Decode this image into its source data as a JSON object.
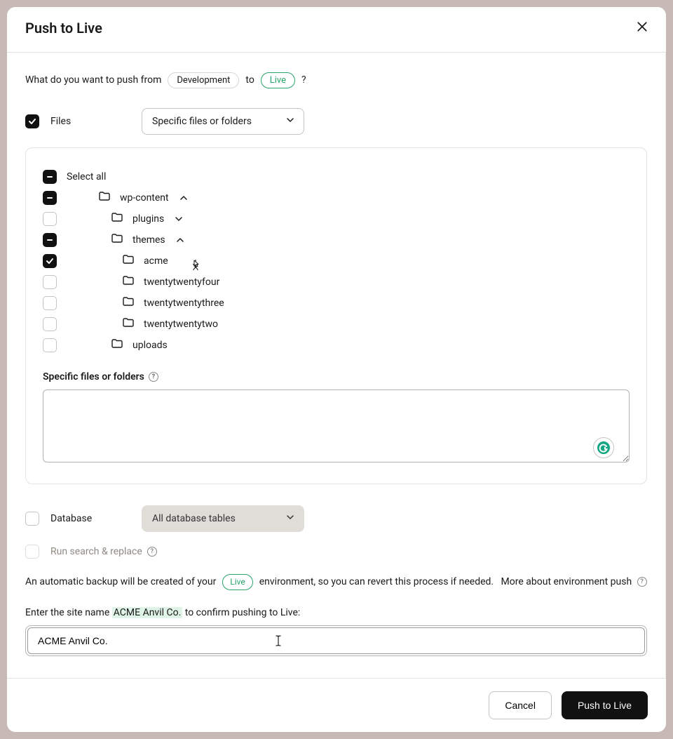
{
  "modal": {
    "title": "Push to Live"
  },
  "question": {
    "prefix": "What do you want to push from",
    "source": "Development",
    "middle": "to",
    "target": "Live",
    "suffix": "?"
  },
  "files": {
    "label": "Files",
    "select": "Specific files or folders"
  },
  "tree": {
    "select_all": "Select all",
    "wp_content": "wp-content",
    "plugins": "plugins",
    "themes": "themes",
    "acme": "acme",
    "twentyfour": "twentytwentyfour",
    "twentythree": "twentytwentythree",
    "twentytwo": "twentytwentytwo",
    "uploads": "uploads"
  },
  "paths_label": "Specific files or folders",
  "database": {
    "label": "Database",
    "select": "All database tables"
  },
  "search_replace": "Run search & replace",
  "backup": {
    "pre": "An automatic backup will be created of your",
    "env": "Live",
    "post": "environment, so you can revert this process if needed.",
    "more": "More about environment push"
  },
  "confirm": {
    "pre": "Enter the site name",
    "site": "ACME Anvil Co.",
    "post": "to confirm pushing to Live:",
    "value": "ACME Anvil Co."
  },
  "footer": {
    "cancel": "Cancel",
    "push": "Push to Live"
  }
}
